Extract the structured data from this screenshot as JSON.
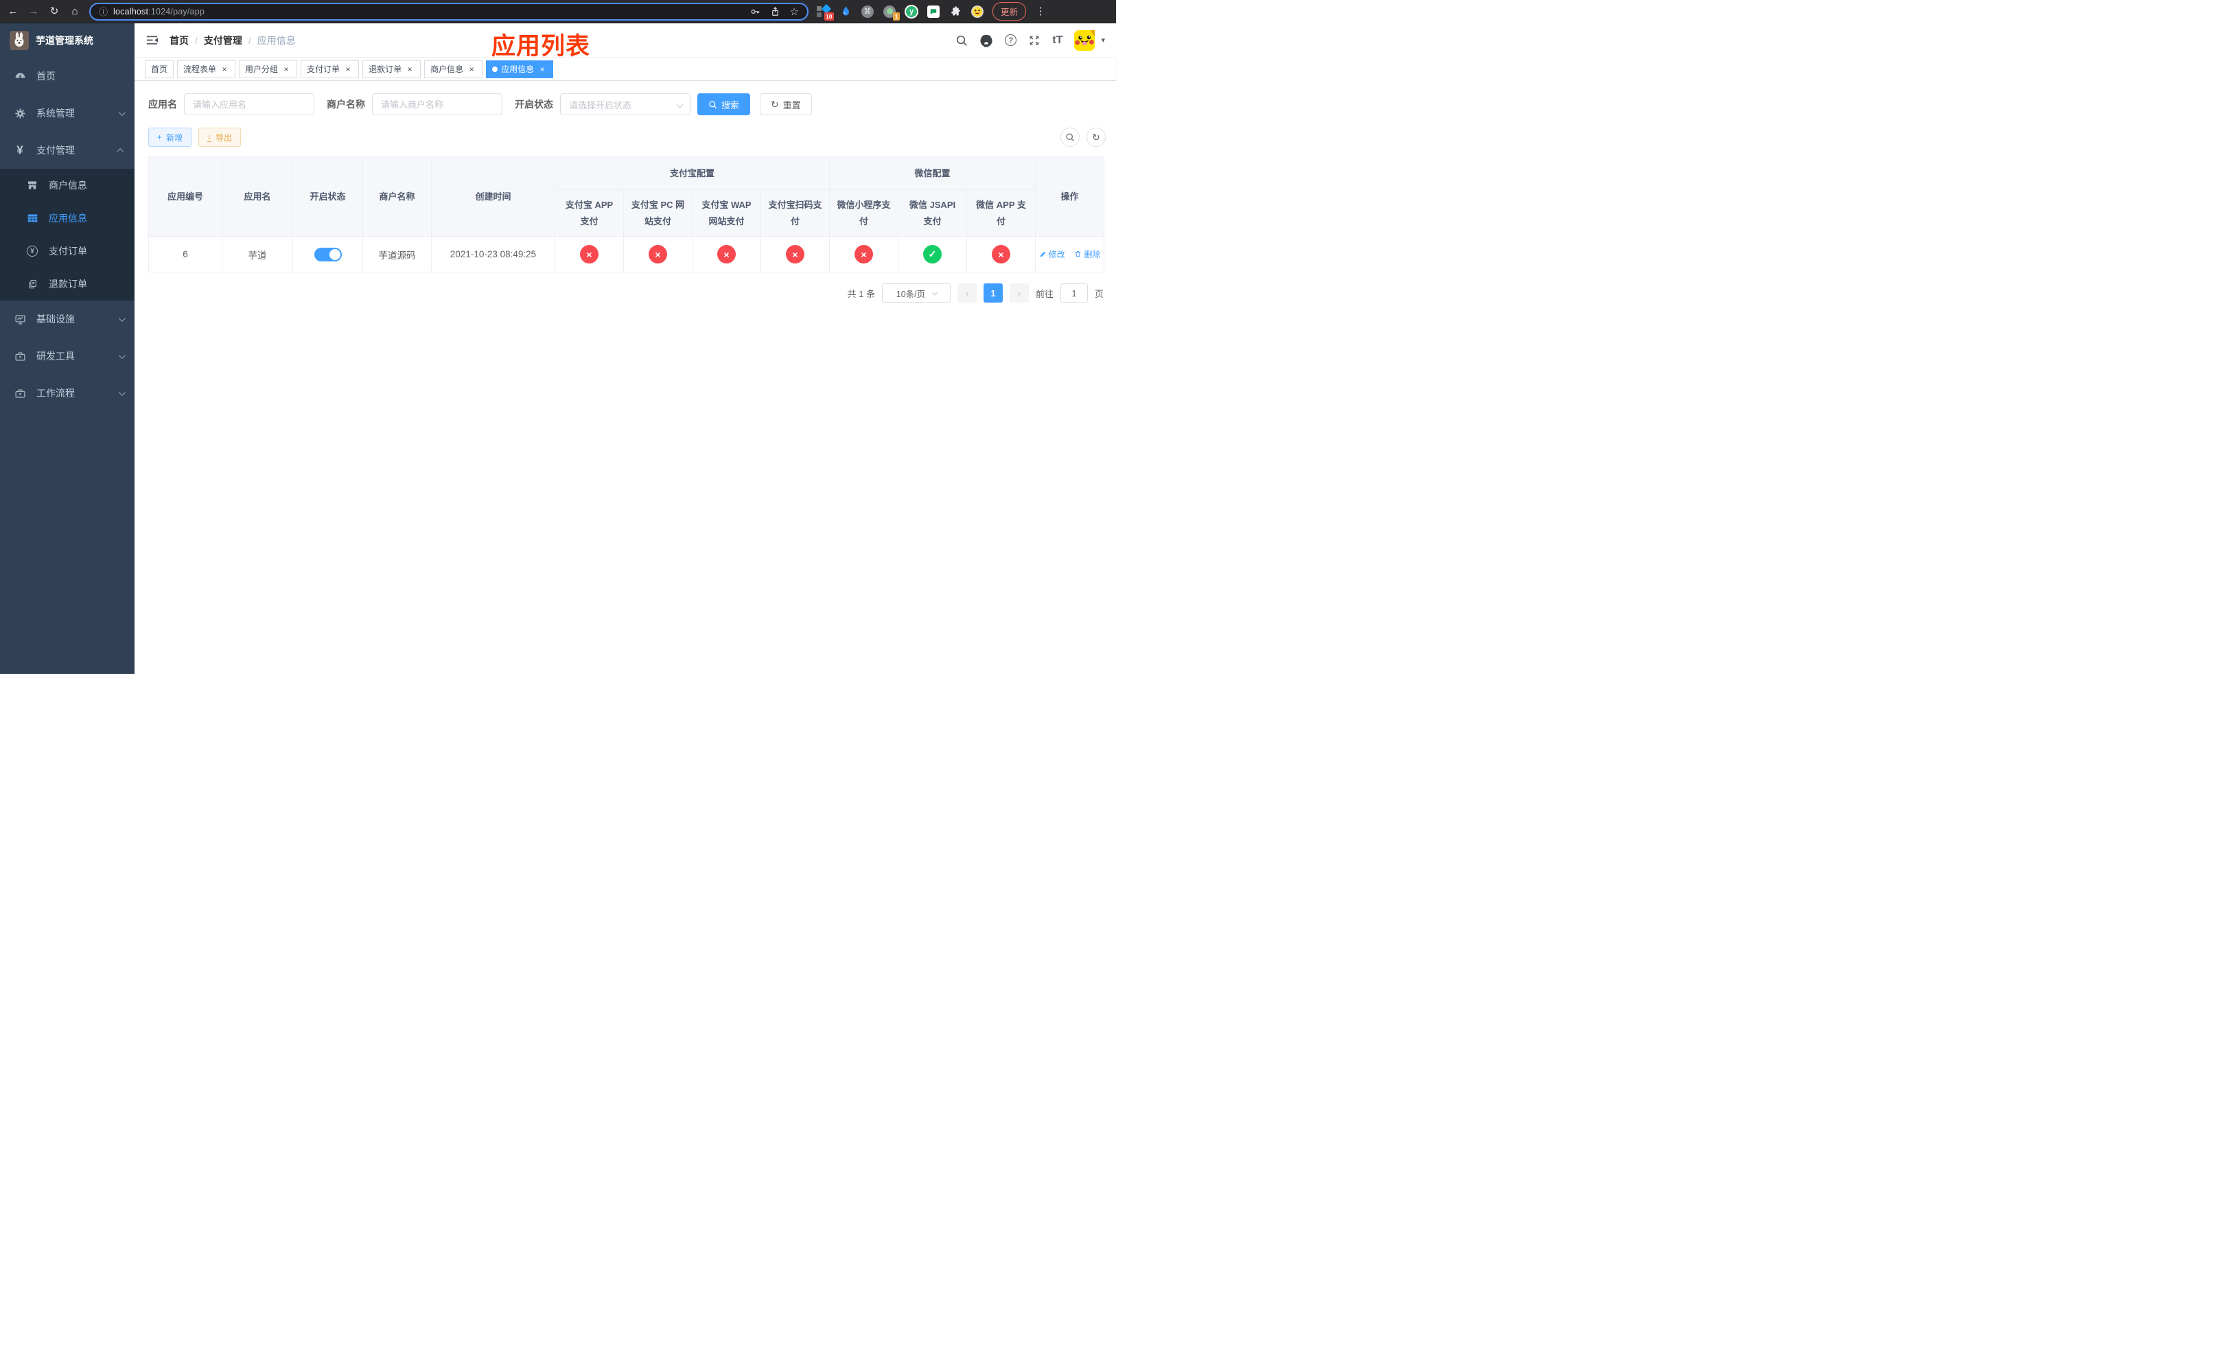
{
  "browser": {
    "url_host": "localhost",
    "url_path": ":1024/pay/app",
    "update_button": "更新",
    "ext_badge_pink": "10",
    "ext_badge_gray": "1"
  },
  "glyphs": {
    "back": "←",
    "forward": "→",
    "reload": "↻",
    "home": "⌂",
    "info": "ⓘ",
    "star": "☆",
    "dots": "⋮",
    "cmd": "⌘",
    "caret_down": "▾",
    "close": "×",
    "check": "✓",
    "cross": "×",
    "plus": "+",
    "chev_left": "‹",
    "chev_right": "›",
    "question": "?",
    "font_size": "tT",
    "download": "↓",
    "reset_arrow": "↻",
    "y_logo": "y"
  },
  "sidebar": {
    "title": "芋道管理系统",
    "items": [
      {
        "label": "首页"
      },
      {
        "label": "系统管理"
      },
      {
        "label": "支付管理"
      },
      {
        "label": "基础设施"
      },
      {
        "label": "研发工具"
      },
      {
        "label": "工作流程"
      }
    ],
    "submenu": [
      {
        "label": "商户信息"
      },
      {
        "label": "应用信息",
        "active": true
      },
      {
        "label": "支付订单"
      },
      {
        "label": "退款订单"
      }
    ]
  },
  "header": {
    "breadcrumb": [
      "首页",
      "支付管理",
      "应用信息"
    ],
    "annotation": "应用列表"
  },
  "tabs": [
    {
      "label": "首页"
    },
    {
      "label": "流程表单"
    },
    {
      "label": "用户分组"
    },
    {
      "label": "支付订单"
    },
    {
      "label": "退款订单"
    },
    {
      "label": "商户信息"
    },
    {
      "label": "应用信息",
      "active": true
    }
  ],
  "filters": {
    "app_name_label": "应用名",
    "app_name_placeholder": "请输入应用名",
    "merchant_label": "商户名称",
    "merchant_placeholder": "请输入商户名称",
    "status_label": "开启状态",
    "status_placeholder": "请选择开启状态",
    "search_button": "搜索",
    "reset_button": "重置"
  },
  "toolbar": {
    "add_button": "新增",
    "export_button": "导出"
  },
  "table": {
    "group_alipay": "支付宝配置",
    "group_wechat": "微信配置",
    "columns": [
      "应用编号",
      "应用名",
      "开启状态",
      "商户名称",
      "创建时间"
    ],
    "channel_columns": [
      "支付宝 APP 支付",
      "支付宝 PC 网站支付",
      "支付宝 WAP 网站支付",
      "支付宝扫码支付",
      "微信小程序支付",
      "微信 JSAPI 支付",
      "微信 APP 支付"
    ],
    "actions_column": "操作",
    "row": {
      "id": "6",
      "name": "芋道",
      "enabled": true,
      "merchant": "芋道源码",
      "created_at": "2021-10-23 08:49:25",
      "channels": [
        false,
        false,
        false,
        false,
        false,
        true,
        false
      ],
      "edit": "修改",
      "delete": "删除"
    }
  },
  "pagination": {
    "total": "共 1 条",
    "page_size": "10条/页",
    "current": "1",
    "goto_label": "前往",
    "goto_value": "1",
    "unit": "页"
  },
  "colors": {
    "accent": "#409eff",
    "success": "#13ce66",
    "danger": "#f7494f",
    "warning": "#e6a23c",
    "sidebar_bg": "#304156",
    "submenu_bg": "#1f2d3d",
    "annotation_red": "#fa3b09"
  }
}
